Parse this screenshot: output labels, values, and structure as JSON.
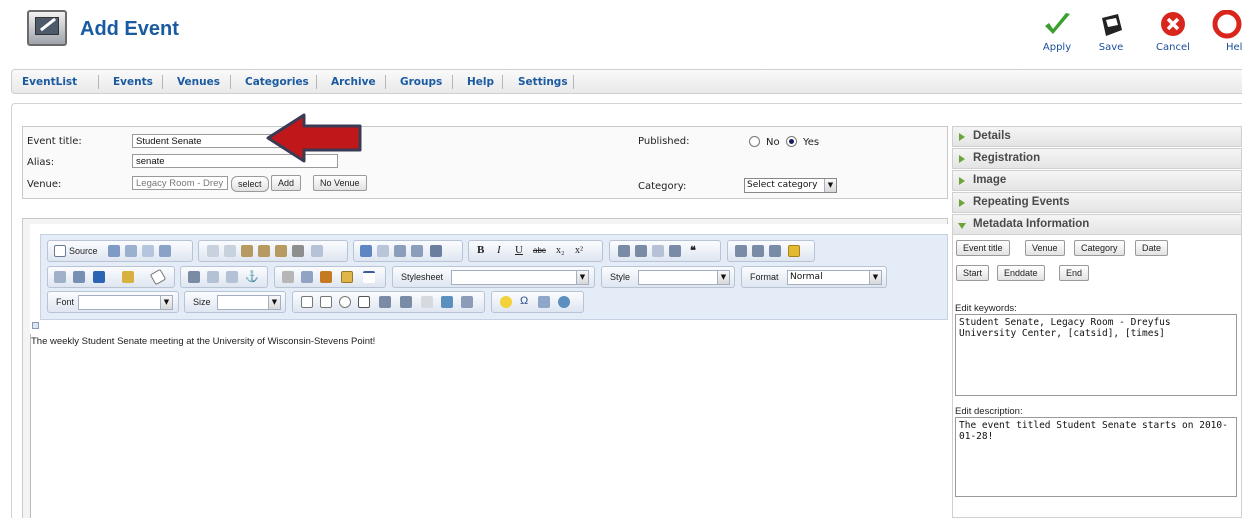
{
  "header": {
    "title": "Add Event",
    "toolbar": [
      {
        "id": "apply",
        "label": "Apply"
      },
      {
        "id": "save",
        "label": "Save"
      },
      {
        "id": "cancel",
        "label": "Cancel"
      },
      {
        "id": "help",
        "label": "Hel"
      }
    ]
  },
  "nav": {
    "items": [
      "EventList",
      "Events",
      "Venues",
      "Categories",
      "Archive",
      "Groups",
      "Help",
      "Settings"
    ]
  },
  "form": {
    "event_title_label": "Event title:",
    "event_title_value": "Student Senate",
    "alias_label": "Alias:",
    "alias_value": "senate",
    "venue_label": "Venue:",
    "venue_value": "Legacy Room - Drey",
    "select_label": "select",
    "add_label": "Add",
    "no_venue_label": "No Venue",
    "published_label": "Published:",
    "no_label": "No",
    "yes_label": "Yes",
    "published_selected": "Yes",
    "category_label": "Category:",
    "category_value": "Select category"
  },
  "editor": {
    "source_label": "Source",
    "stylesheet_label": "Stylesheet",
    "style_label": "Style",
    "format_label": "Format",
    "format_value": "Normal",
    "font_label": "Font",
    "size_label": "Size",
    "content": "The weekly Student Senate meeting at the University of Wisconsin-Stevens Point!"
  },
  "sidebar": {
    "panels": [
      "Details",
      "Registration",
      "Image",
      "Repeating Events",
      "Metadata Information"
    ],
    "meta_buttons_row1": [
      "Event title",
      "Venue",
      "Category",
      "Date"
    ],
    "meta_buttons_row2": [
      "Start",
      "Enddate",
      "End"
    ],
    "keywords_label": "Edit keywords:",
    "keywords_value": "Student Senate, Legacy Room - Dreyfus University Center, [catsid], [times]",
    "description_label": "Edit description:",
    "description_value": "The event titled Student Senate starts on 2010-01-28!"
  },
  "colors": {
    "brand_blue": "#1a5aa0",
    "accordion_green": "#6aa53a",
    "arrow_red": "#c0181a",
    "apply_green": "#3aa12e",
    "cancel_red": "#d9261c"
  }
}
